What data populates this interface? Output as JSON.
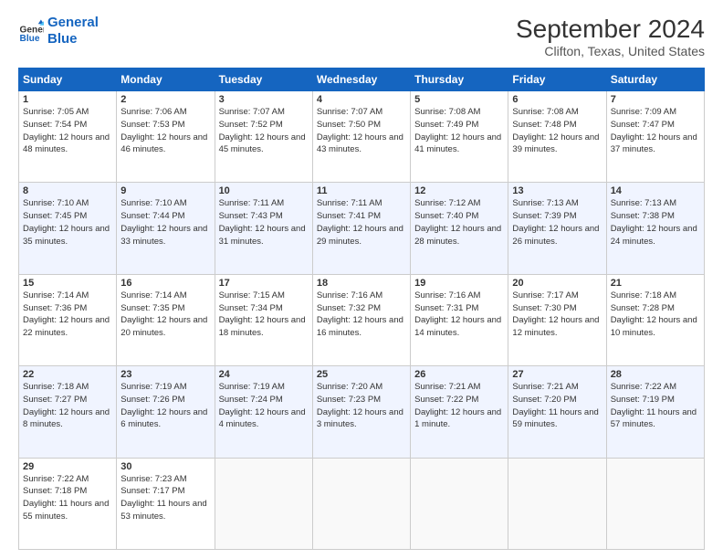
{
  "logo": {
    "line1": "General",
    "line2": "Blue"
  },
  "title": "September 2024",
  "subtitle": "Clifton, Texas, United States",
  "days_header": [
    "Sunday",
    "Monday",
    "Tuesday",
    "Wednesday",
    "Thursday",
    "Friday",
    "Saturday"
  ],
  "weeks": [
    [
      {
        "day": "1",
        "rise": "7:05 AM",
        "set": "7:54 PM",
        "daylight": "12 hours and 48 minutes."
      },
      {
        "day": "2",
        "rise": "7:06 AM",
        "set": "7:53 PM",
        "daylight": "12 hours and 46 minutes."
      },
      {
        "day": "3",
        "rise": "7:07 AM",
        "set": "7:52 PM",
        "daylight": "12 hours and 45 minutes."
      },
      {
        "day": "4",
        "rise": "7:07 AM",
        "set": "7:50 PM",
        "daylight": "12 hours and 43 minutes."
      },
      {
        "day": "5",
        "rise": "7:08 AM",
        "set": "7:49 PM",
        "daylight": "12 hours and 41 minutes."
      },
      {
        "day": "6",
        "rise": "7:08 AM",
        "set": "7:48 PM",
        "daylight": "12 hours and 39 minutes."
      },
      {
        "day": "7",
        "rise": "7:09 AM",
        "set": "7:47 PM",
        "daylight": "12 hours and 37 minutes."
      }
    ],
    [
      {
        "day": "8",
        "rise": "7:10 AM",
        "set": "7:45 PM",
        "daylight": "12 hours and 35 minutes."
      },
      {
        "day": "9",
        "rise": "7:10 AM",
        "set": "7:44 PM",
        "daylight": "12 hours and 33 minutes."
      },
      {
        "day": "10",
        "rise": "7:11 AM",
        "set": "7:43 PM",
        "daylight": "12 hours and 31 minutes."
      },
      {
        "day": "11",
        "rise": "7:11 AM",
        "set": "7:41 PM",
        "daylight": "12 hours and 29 minutes."
      },
      {
        "day": "12",
        "rise": "7:12 AM",
        "set": "7:40 PM",
        "daylight": "12 hours and 28 minutes."
      },
      {
        "day": "13",
        "rise": "7:13 AM",
        "set": "7:39 PM",
        "daylight": "12 hours and 26 minutes."
      },
      {
        "day": "14",
        "rise": "7:13 AM",
        "set": "7:38 PM",
        "daylight": "12 hours and 24 minutes."
      }
    ],
    [
      {
        "day": "15",
        "rise": "7:14 AM",
        "set": "7:36 PM",
        "daylight": "12 hours and 22 minutes."
      },
      {
        "day": "16",
        "rise": "7:14 AM",
        "set": "7:35 PM",
        "daylight": "12 hours and 20 minutes."
      },
      {
        "day": "17",
        "rise": "7:15 AM",
        "set": "7:34 PM",
        "daylight": "12 hours and 18 minutes."
      },
      {
        "day": "18",
        "rise": "7:16 AM",
        "set": "7:32 PM",
        "daylight": "12 hours and 16 minutes."
      },
      {
        "day": "19",
        "rise": "7:16 AM",
        "set": "7:31 PM",
        "daylight": "12 hours and 14 minutes."
      },
      {
        "day": "20",
        "rise": "7:17 AM",
        "set": "7:30 PM",
        "daylight": "12 hours and 12 minutes."
      },
      {
        "day": "21",
        "rise": "7:18 AM",
        "set": "7:28 PM",
        "daylight": "12 hours and 10 minutes."
      }
    ],
    [
      {
        "day": "22",
        "rise": "7:18 AM",
        "set": "7:27 PM",
        "daylight": "12 hours and 8 minutes."
      },
      {
        "day": "23",
        "rise": "7:19 AM",
        "set": "7:26 PM",
        "daylight": "12 hours and 6 minutes."
      },
      {
        "day": "24",
        "rise": "7:19 AM",
        "set": "7:24 PM",
        "daylight": "12 hours and 4 minutes."
      },
      {
        "day": "25",
        "rise": "7:20 AM",
        "set": "7:23 PM",
        "daylight": "12 hours and 3 minutes."
      },
      {
        "day": "26",
        "rise": "7:21 AM",
        "set": "7:22 PM",
        "daylight": "12 hours and 1 minute."
      },
      {
        "day": "27",
        "rise": "7:21 AM",
        "set": "7:20 PM",
        "daylight": "11 hours and 59 minutes."
      },
      {
        "day": "28",
        "rise": "7:22 AM",
        "set": "7:19 PM",
        "daylight": "11 hours and 57 minutes."
      }
    ],
    [
      {
        "day": "29",
        "rise": "7:22 AM",
        "set": "7:18 PM",
        "daylight": "11 hours and 55 minutes."
      },
      {
        "day": "30",
        "rise": "7:23 AM",
        "set": "7:17 PM",
        "daylight": "11 hours and 53 minutes."
      },
      null,
      null,
      null,
      null,
      null
    ]
  ]
}
